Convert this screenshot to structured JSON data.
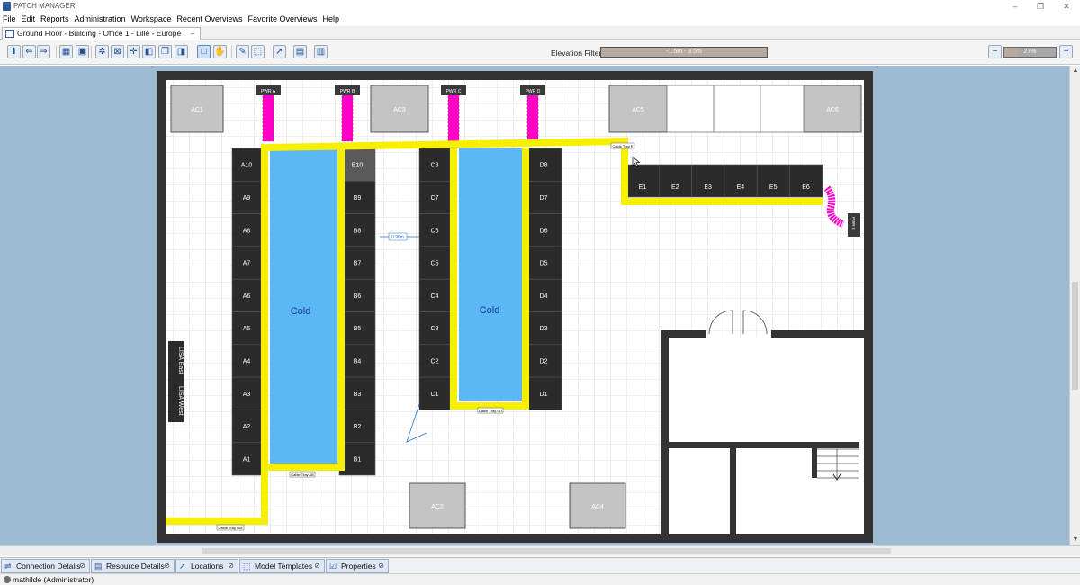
{
  "app": {
    "title": "PATCH MANAGER"
  },
  "window_controls": {
    "minimize": "–",
    "restore": "❐",
    "close": "✕"
  },
  "menu": [
    "File",
    "Edit",
    "Reports",
    "Administration",
    "Workspace",
    "Recent Overviews",
    "Favorite Overviews",
    "Help"
  ],
  "document_tab": {
    "label": "Ground Floor - Building - Office 1 - Lille - Europe",
    "close": "–"
  },
  "toolbar": {
    "buttons": [
      {
        "name": "go-up-icon",
        "glyph": "⬆"
      },
      {
        "name": "back-icon",
        "glyph": "⇐"
      },
      {
        "name": "forward-icon",
        "glyph": "⇒"
      },
      {
        "name": "rack-view-icon",
        "glyph": "▦"
      },
      {
        "name": "print-icon",
        "glyph": "▣"
      },
      {
        "name": "settings-icon",
        "glyph": "✲"
      },
      {
        "name": "connect-icon",
        "glyph": "⊠"
      },
      {
        "name": "move-icon",
        "glyph": "✛"
      },
      {
        "name": "arrange-icon",
        "glyph": "◧"
      },
      {
        "name": "copy-icon",
        "glyph": "❐"
      },
      {
        "name": "paste-icon",
        "glyph": "◨"
      },
      {
        "name": "select-icon",
        "glyph": "□"
      },
      {
        "name": "pan-hand-icon",
        "glyph": "✋"
      },
      {
        "name": "edit-tool-icon",
        "glyph": "✎"
      },
      {
        "name": "marquee-icon",
        "glyph": "⬚"
      },
      {
        "name": "pointer-zoom-icon",
        "glyph": "➚"
      },
      {
        "name": "window-icon",
        "glyph": "▤"
      },
      {
        "name": "grid-icon",
        "glyph": "▥"
      }
    ],
    "elevation_label": "Elevation Filter:",
    "elevation_value": "-1.5m - 3.5m",
    "zoom_value": "27%",
    "zoom_level": 0.27,
    "zoom_out_glyph": "−",
    "zoom_in_glyph": "+"
  },
  "floorplan": {
    "ac_units": [
      "AC1",
      "AC3",
      "AC5",
      "AC6",
      "AC2",
      "AC4"
    ],
    "power": [
      "PWR A",
      "PWR B",
      "PWR C",
      "PWR D",
      "PWR E"
    ],
    "rack_rows": {
      "A": [
        "A10",
        "A9",
        "A8",
        "A7",
        "A6",
        "A5",
        "A4",
        "A3",
        "A2",
        "A1"
      ],
      "B": [
        "B10",
        "B9",
        "B8",
        "B7",
        "B6",
        "B5",
        "B4",
        "B3",
        "B2",
        "B1"
      ],
      "C": [
        "C8",
        "C7",
        "C6",
        "C5",
        "C4",
        "C3",
        "C2",
        "C1"
      ],
      "D": [
        "D8",
        "D7",
        "D6",
        "D5",
        "D4",
        "D3",
        "D2",
        "D1"
      ],
      "E": [
        "E1",
        "E2",
        "E3",
        "E4",
        "E5",
        "E6"
      ]
    },
    "cold_aisles": [
      "Cold",
      "Cold"
    ],
    "side_labels": [
      "LISA East",
      "LISA West"
    ],
    "cable_tray_labels": [
      "Cable Tray AB",
      "Cable Tray CD",
      "Cable Tray E",
      "Cable Tray Out"
    ],
    "measure_label": "0.96m",
    "colors": {
      "cable_tray": "#f7ef00",
      "power": "#ff00c8",
      "cold_aisle": "#5cb8f5",
      "rack": "#2b2b2b",
      "floor": "#ffffff"
    }
  },
  "bottom_tabs": [
    {
      "label": "Connection Details",
      "icon": "⇌"
    },
    {
      "label": "Resource Details",
      "icon": "▤"
    },
    {
      "label": "Locations",
      "icon": "➚"
    },
    {
      "label": "Model Templates",
      "icon": "⬚"
    },
    {
      "label": "Properties",
      "icon": "☑"
    }
  ],
  "status": {
    "user": "mathilde (Administrator)"
  }
}
